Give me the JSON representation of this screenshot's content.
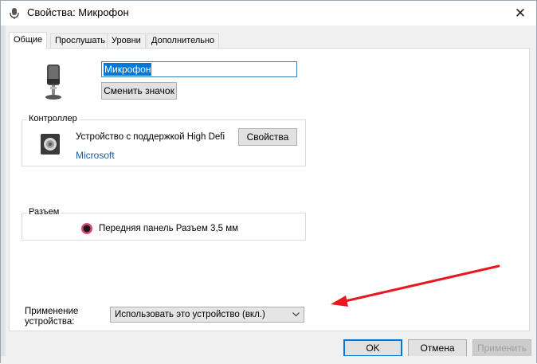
{
  "window": {
    "title": "Свойства: Микрофон",
    "close_glyph": "✕"
  },
  "tabs": [
    {
      "label": "Общие",
      "active": true
    },
    {
      "label": "Прослушать",
      "active": false
    },
    {
      "label": "Уровни",
      "active": false
    },
    {
      "label": "Дополнительно",
      "active": false
    }
  ],
  "general": {
    "device_name": "Микрофон",
    "change_icon_label": "Сменить значок",
    "controller": {
      "group_label": "Контроллер",
      "name": "Устройство с поддержкой High Defi",
      "vendor": "Microsoft",
      "properties_label": "Свойства"
    },
    "jack": {
      "group_label": "Разъем",
      "description": "Передняя панель Разъем 3,5 мм",
      "color": "#e0457b"
    },
    "usage": {
      "label_line1": "Применение",
      "label_line2": "устройства:",
      "selected": "Использовать это устройство (вкл.)"
    }
  },
  "footer": {
    "ok_label": "OK",
    "cancel_label": "Отмена",
    "apply_label": "Применить"
  },
  "icons": {
    "title": "microphone-icon",
    "device": "microphone-icon",
    "controller": "speaker-icon",
    "jack": "audio-jack-icon",
    "annotation": "red-arrow-icon"
  },
  "colors": {
    "accent": "#0078d7",
    "link": "#1e5aa0",
    "annotation_arrow": "#e8191e"
  }
}
